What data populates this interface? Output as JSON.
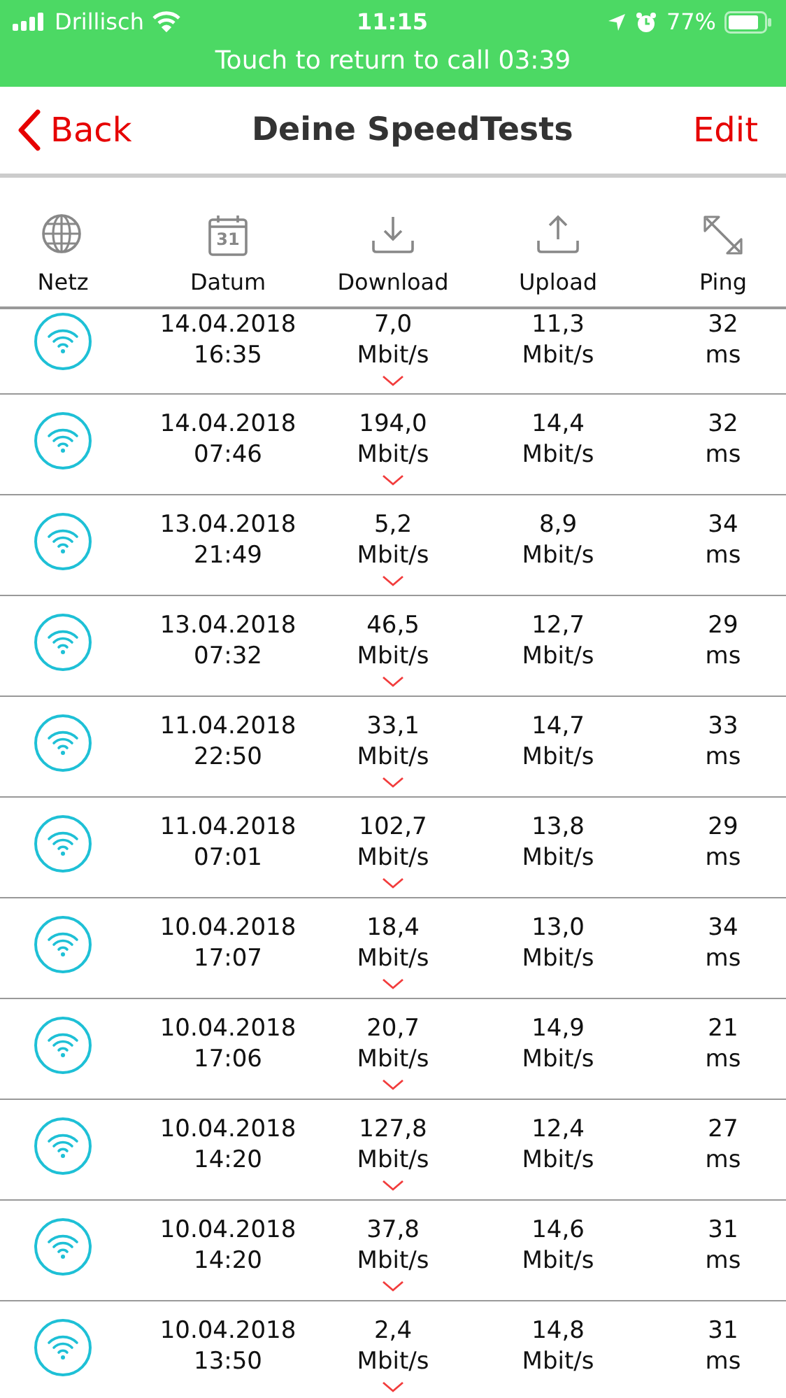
{
  "status_bar": {
    "carrier": "Drillisch",
    "time": "11:15",
    "battery": "77%"
  },
  "call_banner": {
    "text": "Touch to return to call 03:39"
  },
  "nav": {
    "back": "Back",
    "title": "Deine SpeedTests",
    "edit": "Edit"
  },
  "columns": [
    {
      "kind": "network",
      "label": "Netz"
    },
    {
      "kind": "date",
      "label": "Datum",
      "day": "31"
    },
    {
      "kind": "download",
      "label": "Download"
    },
    {
      "kind": "upload",
      "label": "Upload"
    },
    {
      "kind": "ping",
      "label": "Ping"
    }
  ],
  "rows": [
    {
      "kind": "wifi",
      "date": "14.04.2018",
      "time": "16:35",
      "download": "7,0",
      "download_unit": "Mbit/s",
      "upload": "11,3",
      "upload_unit": "Mbit/s",
      "ping": "32",
      "ping_unit": "ms"
    },
    {
      "kind": "wifi",
      "date": "14.04.2018",
      "time": "07:46",
      "download": "194,0",
      "download_unit": "Mbit/s",
      "upload": "14,4",
      "upload_unit": "Mbit/s",
      "ping": "32",
      "ping_unit": "ms"
    },
    {
      "kind": "wifi",
      "date": "13.04.2018",
      "time": "21:49",
      "download": "5,2",
      "download_unit": "Mbit/s",
      "upload": "8,9",
      "upload_unit": "Mbit/s",
      "ping": "34",
      "ping_unit": "ms"
    },
    {
      "kind": "wifi",
      "date": "13.04.2018",
      "time": "07:32",
      "download": "46,5",
      "download_unit": "Mbit/s",
      "upload": "12,7",
      "upload_unit": "Mbit/s",
      "ping": "29",
      "ping_unit": "ms"
    },
    {
      "kind": "wifi",
      "date": "11.04.2018",
      "time": "22:50",
      "download": "33,1",
      "download_unit": "Mbit/s",
      "upload": "14,7",
      "upload_unit": "Mbit/s",
      "ping": "33",
      "ping_unit": "ms"
    },
    {
      "kind": "wifi",
      "date": "11.04.2018",
      "time": "07:01",
      "download": "102,7",
      "download_unit": "Mbit/s",
      "upload": "13,8",
      "upload_unit": "Mbit/s",
      "ping": "29",
      "ping_unit": "ms"
    },
    {
      "kind": "wifi",
      "date": "10.04.2018",
      "time": "17:07",
      "download": "18,4",
      "download_unit": "Mbit/s",
      "upload": "13,0",
      "upload_unit": "Mbit/s",
      "ping": "34",
      "ping_unit": "ms"
    },
    {
      "kind": "wifi",
      "date": "10.04.2018",
      "time": "17:06",
      "download": "20,7",
      "download_unit": "Mbit/s",
      "upload": "14,9",
      "upload_unit": "Mbit/s",
      "ping": "21",
      "ping_unit": "ms"
    },
    {
      "kind": "wifi",
      "date": "10.04.2018",
      "time": "14:20",
      "download": "127,8",
      "download_unit": "Mbit/s",
      "upload": "12,4",
      "upload_unit": "Mbit/s",
      "ping": "27",
      "ping_unit": "ms"
    },
    {
      "kind": "wifi",
      "date": "10.04.2018",
      "time": "14:20",
      "download": "37,8",
      "download_unit": "Mbit/s",
      "upload": "14,6",
      "upload_unit": "Mbit/s",
      "ping": "31",
      "ping_unit": "ms"
    },
    {
      "kind": "wifi",
      "date": "10.04.2018",
      "time": "13:50",
      "download": "2,4",
      "download_unit": "Mbit/s",
      "upload": "14,8",
      "upload_unit": "Mbit/s",
      "ping": "31",
      "ping_unit": "ms"
    }
  ]
}
